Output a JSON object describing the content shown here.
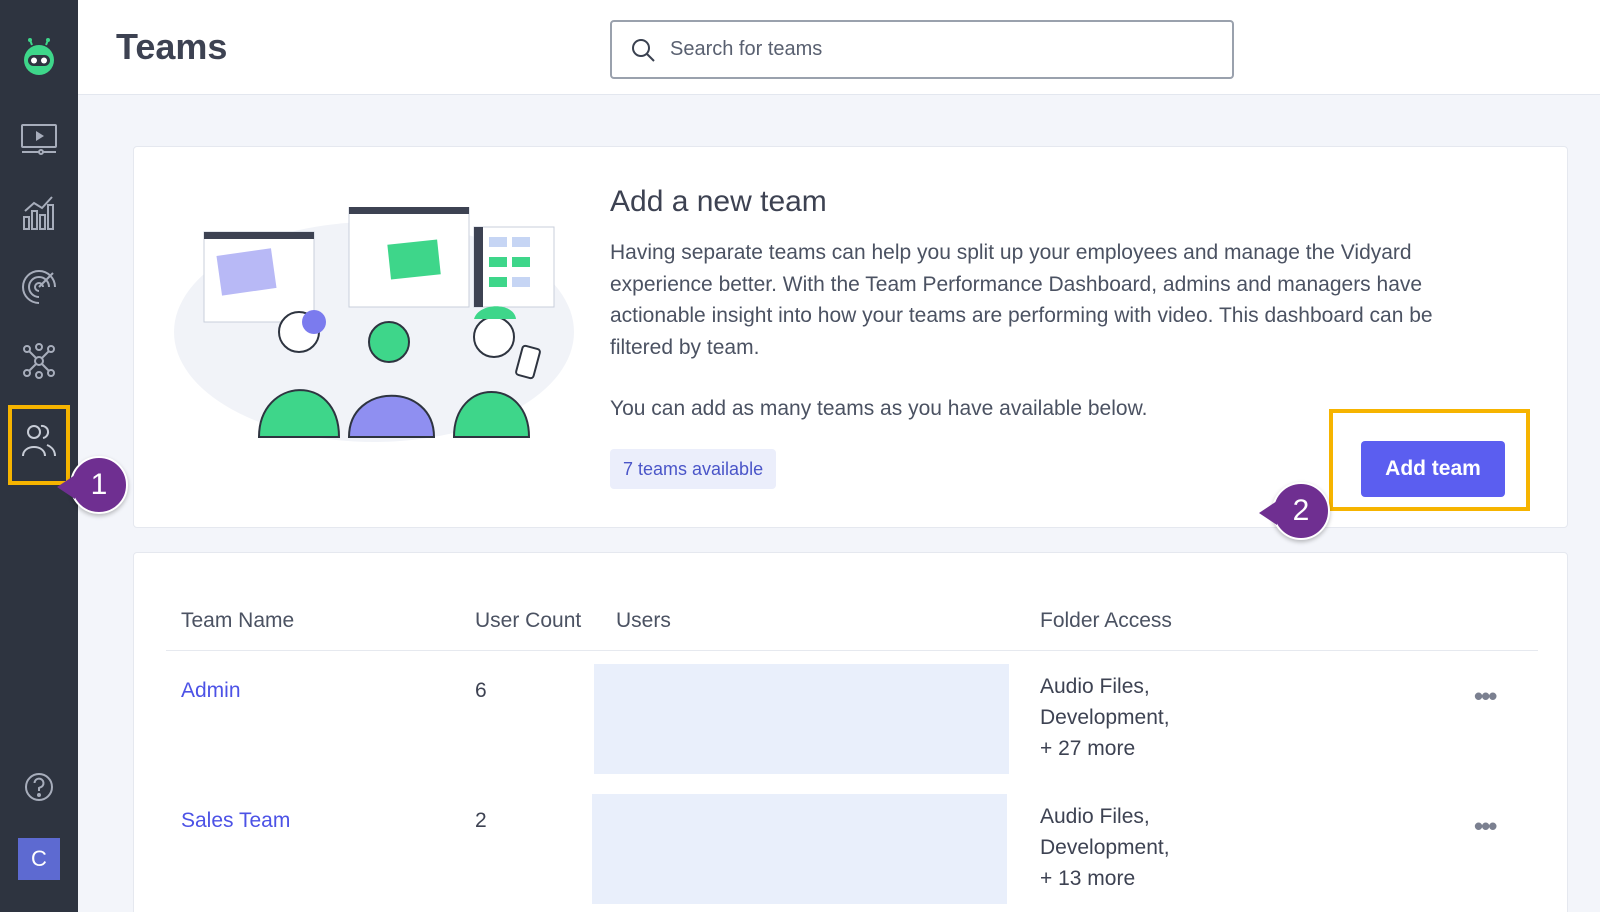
{
  "header": {
    "title": "Teams",
    "search_placeholder": "Search for teams"
  },
  "sidebar": {
    "items": [
      {
        "name": "logo",
        "icon": "robot-logo-icon"
      },
      {
        "name": "videos",
        "icon": "video-library-icon"
      },
      {
        "name": "analytics",
        "icon": "bar-chart-icon"
      },
      {
        "name": "engagement",
        "icon": "target-icon"
      },
      {
        "name": "integrations",
        "icon": "network-icon"
      },
      {
        "name": "teams",
        "icon": "users-icon",
        "active": true
      },
      {
        "name": "help",
        "icon": "help-icon"
      }
    ],
    "avatar_initial": "C"
  },
  "add_team_card": {
    "title": "Add a new team",
    "description": "Having separate teams can help you split up your employees and manage the Vidyard experience better. With the Team Performance Dashboard, admins and managers have actionable insight into how your teams are performing with video. This dashboard can be filtered by team.",
    "description2": "You can add as many teams as you have available below.",
    "badge": "7 teams available",
    "button_label": "Add team"
  },
  "callouts": {
    "step1": "1",
    "step2": "2"
  },
  "colors": {
    "sidebar_bg": "#2e3440",
    "accent": "#5b5ef0",
    "highlight": "#f6b400",
    "callout": "#6f2f91",
    "link": "#4c52e6"
  },
  "table": {
    "headers": {
      "team_name": "Team Name",
      "user_count": "User Count",
      "users": "Users",
      "folder_access": "Folder Access"
    },
    "rows": [
      {
        "name": "Admin",
        "count": "6",
        "folders": [
          "Audio Files,",
          "Development,",
          "+ 27 more"
        ]
      },
      {
        "name": "Sales Team",
        "count": "2",
        "folders": [
          "Audio Files,",
          "Development,",
          "+ 13 more"
        ]
      }
    ],
    "more_label": "•••"
  }
}
